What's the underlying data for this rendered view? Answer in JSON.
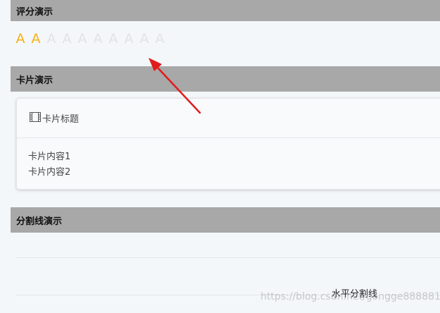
{
  "sections": {
    "rating_title": "评分演示",
    "card_title": "卡片演示",
    "divider_title": "分割线演示"
  },
  "rating": {
    "max": 10,
    "value": 2,
    "glyph": "A",
    "active_color": "#f7b012",
    "inactive_color": "#e2e2e2"
  },
  "card": {
    "icon": "film-icon",
    "title": "卡片标题",
    "lines": [
      "卡片内容1",
      "卡片内容2"
    ]
  },
  "divider": {
    "label": "水平分割线"
  },
  "watermark": "https://blog.csdn.net/gongge8888811",
  "colors": {
    "header_bg": "#a8a8a8",
    "page_bg": "#f4f7fa",
    "arrow": "#e11b1b"
  }
}
